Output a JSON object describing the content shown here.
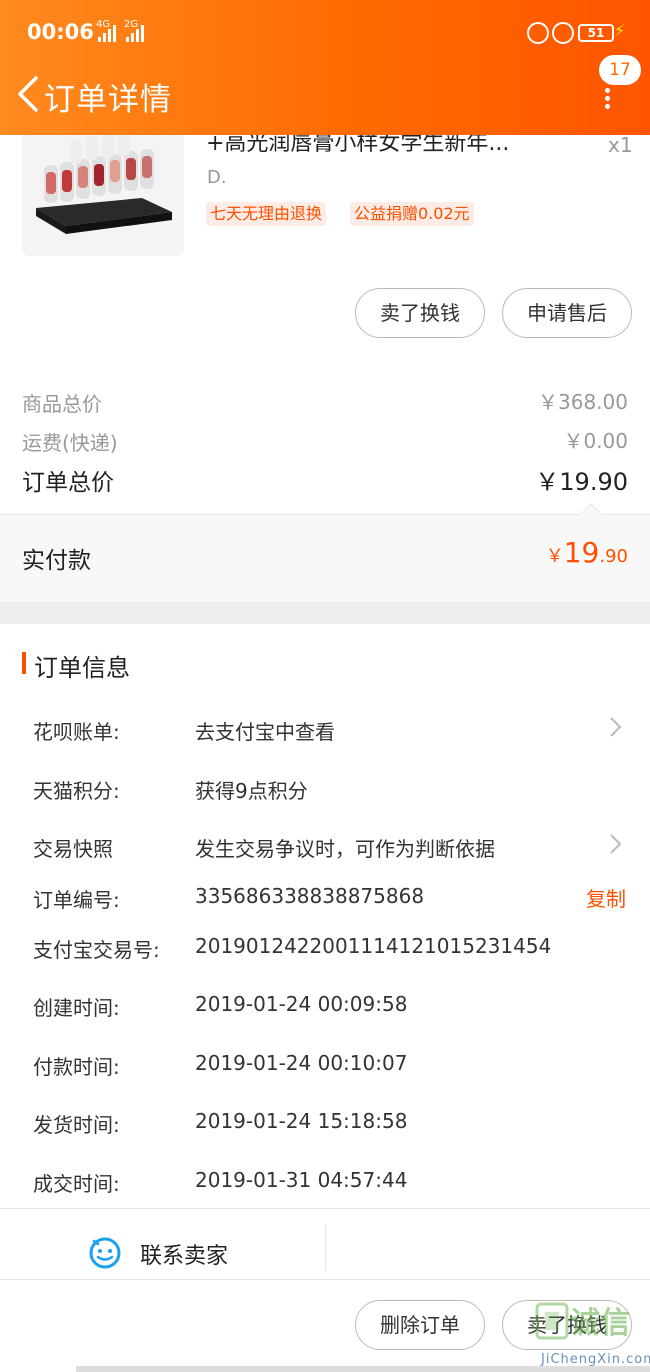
{
  "status_bar": {
    "time": "00:06",
    "net1": "4G",
    "net2": "2G",
    "battery": "51"
  },
  "header": {
    "title": "订单详情",
    "badge_count": "17"
  },
  "product": {
    "title": "+高光润唇膏小样女学生新年...",
    "qty": "x1",
    "sku": "D.",
    "tags": [
      "七天无理由退换",
      "公益捐赠0.02元"
    ]
  },
  "actions": {
    "sell_label": "卖了换钱",
    "after_sale_label": "申请售后"
  },
  "prices": {
    "goods_label": "商品总价",
    "goods_value": "￥368.00",
    "shipping_label": "运费(快递)",
    "shipping_value": "￥0.00",
    "total_label": "订单总价",
    "total_value": "￥19.90"
  },
  "paid": {
    "label": "实付款",
    "currency": "￥",
    "integer": "19",
    "decimal": ".90"
  },
  "order_info": {
    "title": "订单信息",
    "rows": [
      {
        "label": "花呗账单:",
        "value": "去支付宝中查看"
      },
      {
        "label": "天猫积分:",
        "value": "获得9点积分"
      },
      {
        "label": "交易快照",
        "value": "发生交易争议时，可作为判断依据"
      },
      {
        "label": "订单编号:",
        "value": "335686338838875868"
      },
      {
        "label": "支付宝交易号:",
        "value": "2019012422001114121015231454"
      },
      {
        "label": "创建时间:",
        "value": "2019-01-24 00:09:58"
      },
      {
        "label": "付款时间:",
        "value": "2019-01-24 00:10:07"
      },
      {
        "label": "发货时间:",
        "value": "2019-01-24 15:18:58"
      },
      {
        "label": "成交时间:",
        "value": "2019-01-31 04:57:44"
      }
    ],
    "copy_label": "复制"
  },
  "contact": {
    "label": "联系卖家"
  },
  "bottom_actions": {
    "delete_label": "删除订单",
    "sell_label": "卖了换钱"
  },
  "watermark": {
    "text": "诚信",
    "sub": "JiChengXin.com"
  },
  "colors": {
    "accent": "#ff5000",
    "header_start": "#ff8a1f",
    "header_end": "#ff5500"
  }
}
